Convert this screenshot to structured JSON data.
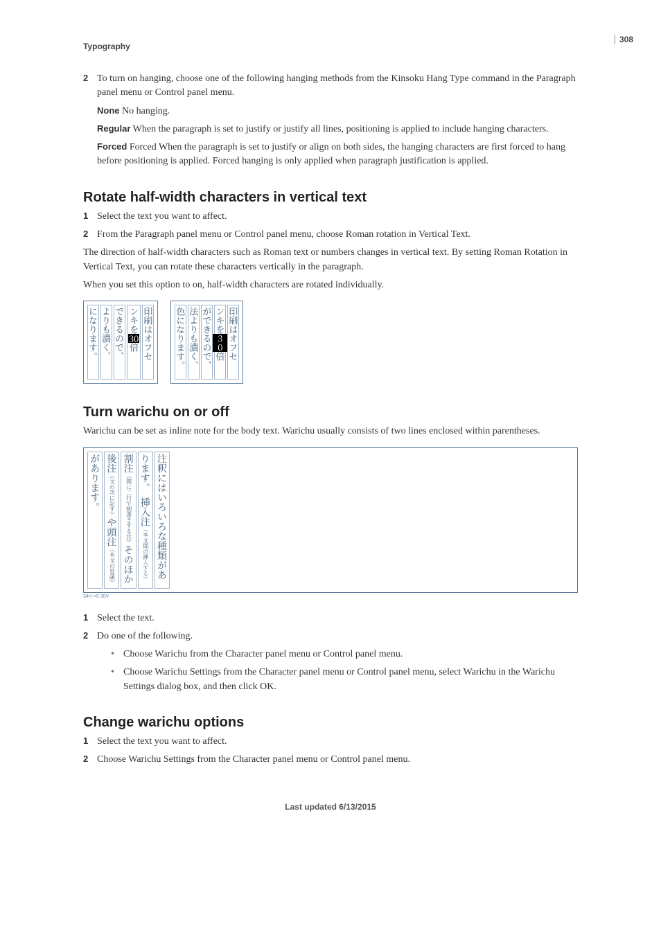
{
  "page_number": "308",
  "header": "Typography",
  "step2": {
    "num": "2",
    "text": "To turn on hanging, choose one of the following hanging methods from the Kinsoku Hang Type command in the Paragraph panel menu or Control panel menu."
  },
  "defs": {
    "none": {
      "term": "None",
      "text": "No hanging."
    },
    "regular": {
      "term": "Regular",
      "text": "When the paragraph is set to justify or justify all lines, positioning is applied to include hanging characters."
    },
    "forced": {
      "term": "Forced",
      "text": "Forced When the paragraph is set to justify or align on both sides, the hanging characters are first forced to hang before positioning is applied. Forced hanging is only applied when paragraph justification is applied."
    }
  },
  "rotate": {
    "heading": "Rotate half-width characters in vertical text",
    "steps": {
      "s1": {
        "num": "1",
        "text": "Select the text you want to affect."
      },
      "s2": {
        "num": "2",
        "text": "From the Paragraph panel menu or Control panel menu, choose Roman rotation in Vertical Text."
      }
    },
    "p1": "The direction of half-width characters such as Roman text or numbers changes in vertical text. By setting Roman Rotation in Vertical Text, you can rotate these characters vertically in the paragraph.",
    "p2": "When you set this option to on, half-width characters are rotated individually.",
    "figure": {
      "left_cols": [
        "になります。",
        "よりも濃く、",
        "できるので、",
        "ンキを",
        "印刷はオフセ"
      ],
      "left_hl": "30",
      "left_tail": "倍",
      "right_cols": [
        "色になります。",
        "法よりも濃く、",
        "ができるので、",
        "ンキを",
        "印刷はオフセ"
      ],
      "right_hl": "30",
      "right_tail": "倍"
    }
  },
  "warichu_onoff": {
    "heading": "Turn warichu on or off",
    "intro": "Warichu can be set as inline note for the body text. Warichu usually consists of two lines enclosed within parentheses.",
    "figure": {
      "cols": [
        {
          "main": "があります。",
          "small": ""
        },
        {
          "main": "後注",
          "small": "（文の次に記す）",
          "tail": "や頭注",
          "small2": "（本文の冒頭）"
        },
        {
          "main": "割注",
          "small": "（間に二行で割書きする注）",
          "tail": "そのほか"
        },
        {
          "main": "ります。　挿入注",
          "small": "（本文間の挿入する）"
        },
        {
          "main": "注釈にはいろいろな種類があ",
          "small": ""
        }
      ],
      "ruler": "34H ×5     30V"
    },
    "steps": {
      "s1": {
        "num": "1",
        "text": "Select the text."
      },
      "s2": {
        "num": "2",
        "text": "Do one of the following."
      }
    },
    "bullets": {
      "b1": "Choose Warichu from the Character panel menu or Control panel menu.",
      "b2": "Choose Warichu Settings from the Character panel menu or Control panel menu, select Warichu in the Warichu Settings dialog box, and then click OK."
    }
  },
  "warichu_opts": {
    "heading": "Change warichu options",
    "steps": {
      "s1": {
        "num": "1",
        "text": "Select the text you want to affect."
      },
      "s2": {
        "num": "2",
        "text": "Choose Warichu Settings from the Character panel menu or Control panel menu."
      }
    }
  },
  "footer": "Last updated 6/13/2015"
}
